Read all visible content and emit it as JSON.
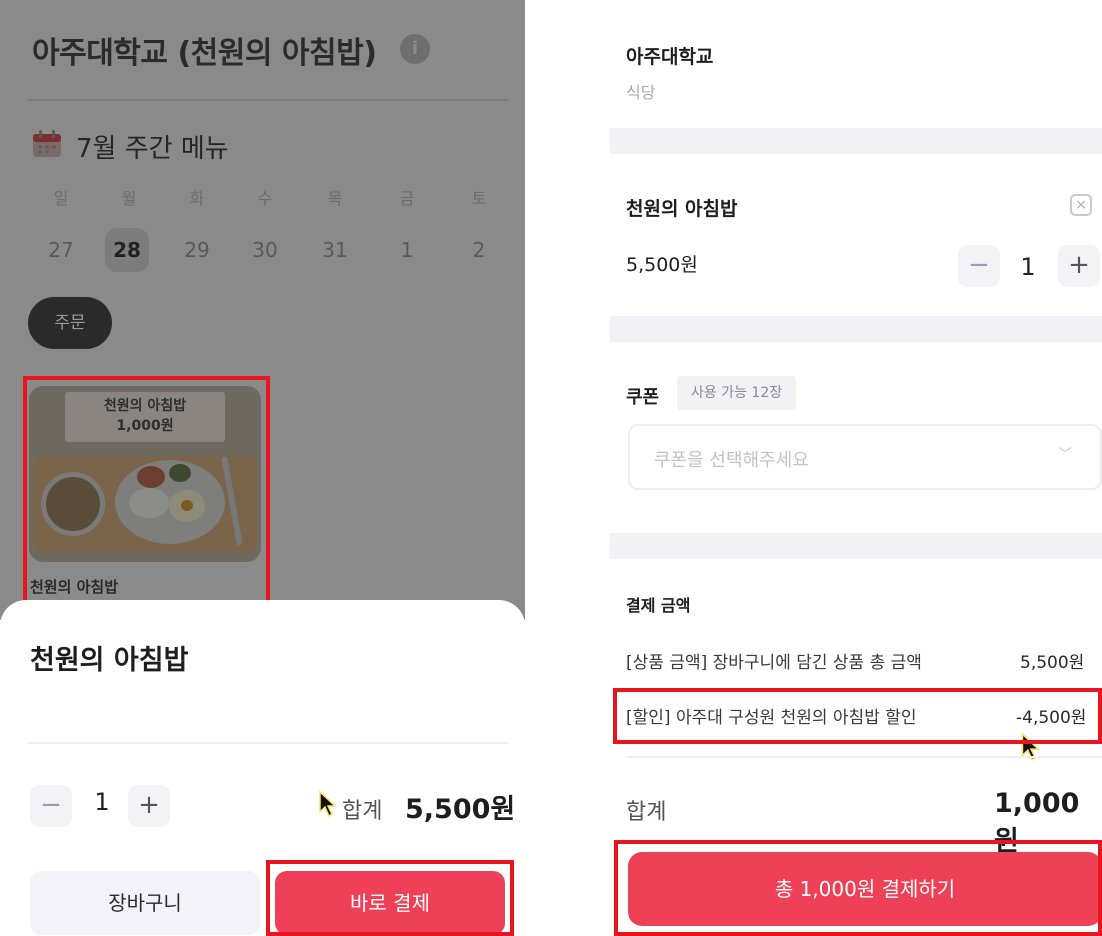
{
  "left": {
    "title": "아주대학교 (천원의 아침밥)",
    "info_icon": "i",
    "week_title": "7월 주간 메뉴",
    "day_names": [
      "일",
      "월",
      "화",
      "수",
      "목",
      "금",
      "토"
    ],
    "dates": [
      "27",
      "28",
      "29",
      "30",
      "31",
      "1",
      "2"
    ],
    "selected_date": "28",
    "order_button": "주문",
    "product_image_sign": {
      "line1": "천원의 아침밥",
      "line2": "1,000원"
    },
    "product_name": "천원의 아침밥",
    "sheet": {
      "title": "천원의 아침밥",
      "minus": "−",
      "quantity": "1",
      "plus": "+",
      "sum_label": "합계",
      "sum_value": "5,500원",
      "cart_button": "장바구니",
      "pay_button": "바로 결제"
    }
  },
  "right": {
    "school": "아주대학교",
    "cafeteria": "식당",
    "item": {
      "name": "천원의 아침밥",
      "price": "5,500원",
      "remove_icon": "×",
      "minus": "−",
      "quantity": "1",
      "plus": "+"
    },
    "coupon": {
      "label": "쿠폰",
      "available": "사용 가능 12장",
      "placeholder": "쿠폰을 선택해주세요",
      "chevron": "﹀"
    },
    "payment": {
      "title": "결제 금액",
      "lines": [
        {
          "label": "[상품 금액] 장바구니에 담긴 상품 총 금액",
          "value": "5,500원"
        },
        {
          "label": "[할인] 아주대 구성원 천원의 아침밥 할인",
          "value": "-4,500원"
        }
      ],
      "total_label": "합계",
      "total_value": "1,000원",
      "pay_button": "총 1,000원 결제하기"
    }
  },
  "colors": {
    "accent": "#ee4056",
    "highlight": "#e8141e",
    "overlay": "#8a8a8a"
  }
}
